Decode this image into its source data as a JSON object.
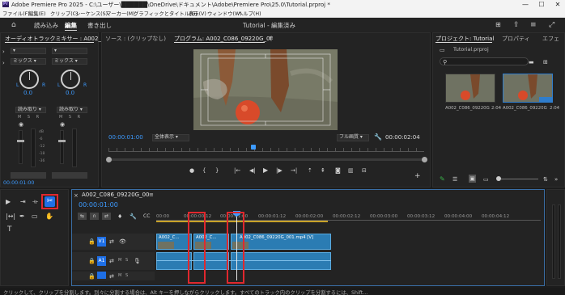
{
  "window": {
    "title": "Adobe Premiere Pro 2025 - C:\\ユーザー\\██████\\OneDrive\\ドキュメント\\Adobe\\Premiere Pro\\25.0\\Tutorial.prproj *",
    "app_icon": "Pr",
    "min_glyph": "—",
    "max_glyph": "☐",
    "close_glyph": "✕"
  },
  "menu": [
    "ファイル(F)",
    "編集(E)",
    "クリップ(C)",
    "シーケンス(S)",
    "マーカー(M)",
    "グラフィックとタイトル(G)",
    "表示(V)",
    "ウィンドウ(W)",
    "ヘルプ(H)"
  ],
  "workspace": {
    "tabs": [
      "読み込み",
      "編集",
      "書き出し"
    ],
    "active": "編集",
    "center_title": "Tutorial - 編集済み"
  },
  "mixer": {
    "title": "オーディオトラックミキサー : A002_C",
    "mix_label": "ミックス",
    "read_label": "読み取り",
    "left": "L",
    "right": "R",
    "value": "0.0",
    "timecode": "00:00:01:00",
    "db_ticks": [
      "dB",
      "-6",
      "-12",
      "-18",
      "-24",
      "-36"
    ]
  },
  "source_tab": "ソース : (クリップなし)",
  "program": {
    "tab": "プログラム: A002_C086_09220G_0(",
    "timecode_left": "00:00:01:00",
    "zoom": "全体表示",
    "quality": "フル画質",
    "timecode_right": "00:00:02:04"
  },
  "project": {
    "tabs": [
      "プロジェクト: Tutorial",
      "プロパティ",
      "エフェ"
    ],
    "file": "Tutorial.prproj",
    "items": [
      {
        "name": "A002_C086_09220G",
        "duration": "2:04"
      },
      {
        "name": "A002_C086_09220G",
        "duration": "2:04"
      }
    ]
  },
  "timeline": {
    "sequence_tab": "A002_C086_09220G_00",
    "timecode": "00:00:01:00",
    "ruler": [
      "00:00",
      "00:00:00:12",
      "00:00:01:00",
      "00:00:01:12",
      "00:00:02:00",
      "00:00:02:12",
      "00:00:03:00",
      "00:00:03:12",
      "00:00:04:00",
      "00:00:04:12"
    ],
    "tracks": [
      "V1",
      "A1"
    ],
    "clip_v1_a": "A002_C...",
    "clip_v1_b": "A002_C...",
    "clip_v1_c": "A002_C086_09220G_001.mp4 [V]",
    "track_letters": {
      "m": "M",
      "s": "S"
    }
  },
  "status": "クリックして、クリップを分割します。別々に分割する場合は、Alt キーを押しながらクリックします。すべてのトラック内のクリップを分割するには、Shift..."
}
